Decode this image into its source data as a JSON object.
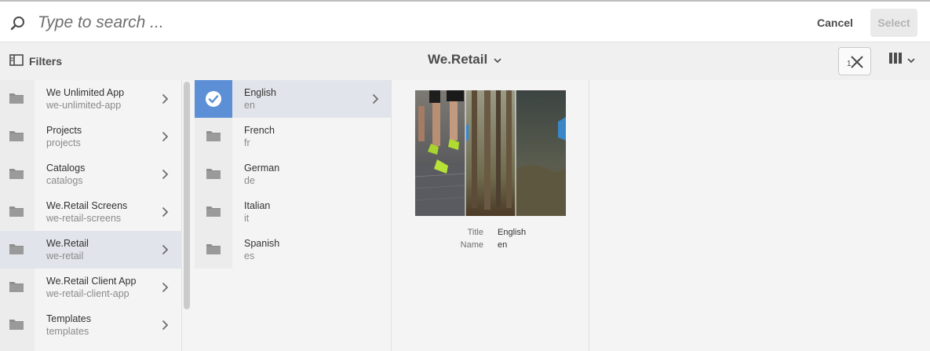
{
  "search": {
    "placeholder": "Type to search ..."
  },
  "actions": {
    "cancel": "Cancel",
    "select": "Select"
  },
  "toolbar": {
    "filters_label": "Filters",
    "title": "We.Retail"
  },
  "column1": [
    {
      "title": "We Unlimited App",
      "name": "we-unlimited-app",
      "selected": false
    },
    {
      "title": "Projects",
      "name": "projects",
      "selected": false
    },
    {
      "title": "Catalogs",
      "name": "catalogs",
      "selected": false
    },
    {
      "title": "We.Retail Screens",
      "name": "we-retail-screens",
      "selected": false
    },
    {
      "title": "We.Retail",
      "name": "we-retail",
      "selected": true
    },
    {
      "title": "We.Retail Client App",
      "name": "we-retail-client-app",
      "selected": false
    },
    {
      "title": "Templates",
      "name": "templates",
      "selected": false
    }
  ],
  "column2": [
    {
      "title": "English",
      "name": "en",
      "selected": true
    },
    {
      "title": "French",
      "name": "fr",
      "selected": false
    },
    {
      "title": "German",
      "name": "de",
      "selected": false
    },
    {
      "title": "Italian",
      "name": "it",
      "selected": false
    },
    {
      "title": "Spanish",
      "name": "es",
      "selected": false
    }
  ],
  "preview": {
    "title_label": "Title",
    "title_value": "English",
    "name_label": "Name",
    "name_value": "en"
  },
  "colors": {
    "accent": "#5c8fd6",
    "selected_row": "#e1e4ea"
  }
}
